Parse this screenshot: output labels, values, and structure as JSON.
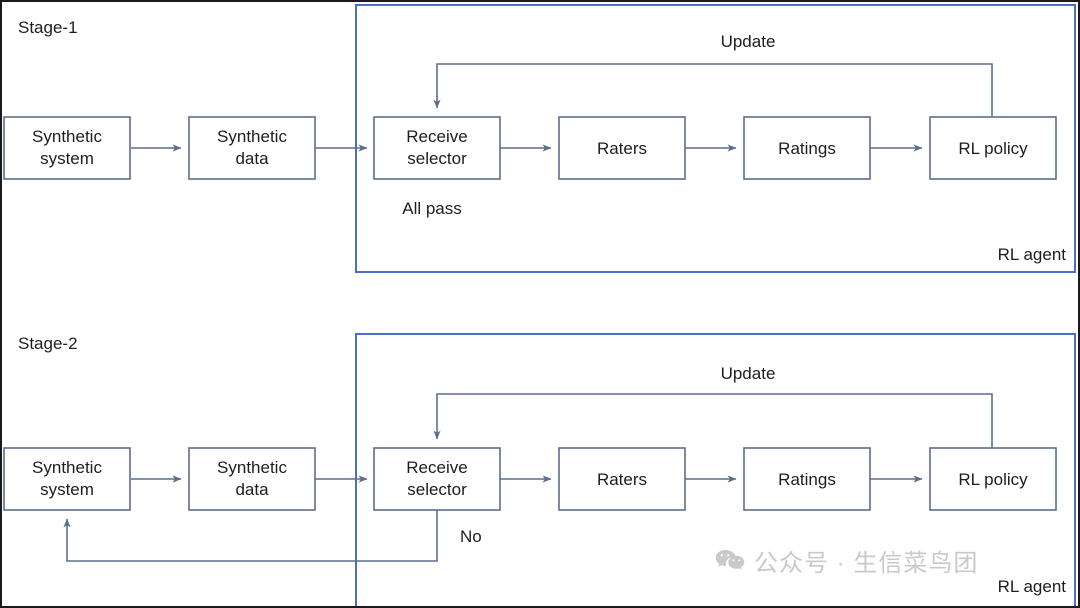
{
  "diagram": {
    "type": "flowchart",
    "title_visible": false,
    "colors": {
      "node_stroke": "#5b6d8c",
      "container_stroke": "#4a6fc4",
      "text": "#1d1d1d",
      "background": "#ffffff",
      "frame": "#1a1a1a",
      "watermark": "#c9c9c9"
    },
    "stages": [
      {
        "id": "stage-1",
        "label": "Stage-1",
        "container_label": "RL agent",
        "nodes": [
          {
            "id": "synthetic-system",
            "label_line1": "Synthetic",
            "label_line2": "system"
          },
          {
            "id": "synthetic-data",
            "label_line1": "Synthetic",
            "label_line2": "data"
          },
          {
            "id": "receive-selector",
            "label_line1": "Receive",
            "label_line2": "selector"
          },
          {
            "id": "raters",
            "label_line1": "Raters",
            "label_line2": ""
          },
          {
            "id": "ratings",
            "label_line1": "Ratings",
            "label_line2": ""
          },
          {
            "id": "rl-policy",
            "label_line1": "RL policy",
            "label_line2": ""
          }
        ],
        "edge_labels": {
          "update": "Update",
          "selector_outcome": "All pass"
        }
      },
      {
        "id": "stage-2",
        "label": "Stage-2",
        "container_label": "RL agent",
        "nodes": [
          {
            "id": "synthetic-system",
            "label_line1": "Synthetic",
            "label_line2": "system"
          },
          {
            "id": "synthetic-data",
            "label_line1": "Synthetic",
            "label_line2": "data"
          },
          {
            "id": "receive-selector",
            "label_line1": "Receive",
            "label_line2": "selector"
          },
          {
            "id": "raters",
            "label_line1": "Raters",
            "label_line2": ""
          },
          {
            "id": "ratings",
            "label_line1": "Ratings",
            "label_line2": ""
          },
          {
            "id": "rl-policy",
            "label_line1": "RL policy",
            "label_line2": ""
          }
        ],
        "edge_labels": {
          "update": "Update",
          "selector_outcome": "No"
        }
      }
    ]
  },
  "watermark": {
    "icon": "wechat-icon",
    "text": "公众号 · 生信菜鸟团"
  }
}
